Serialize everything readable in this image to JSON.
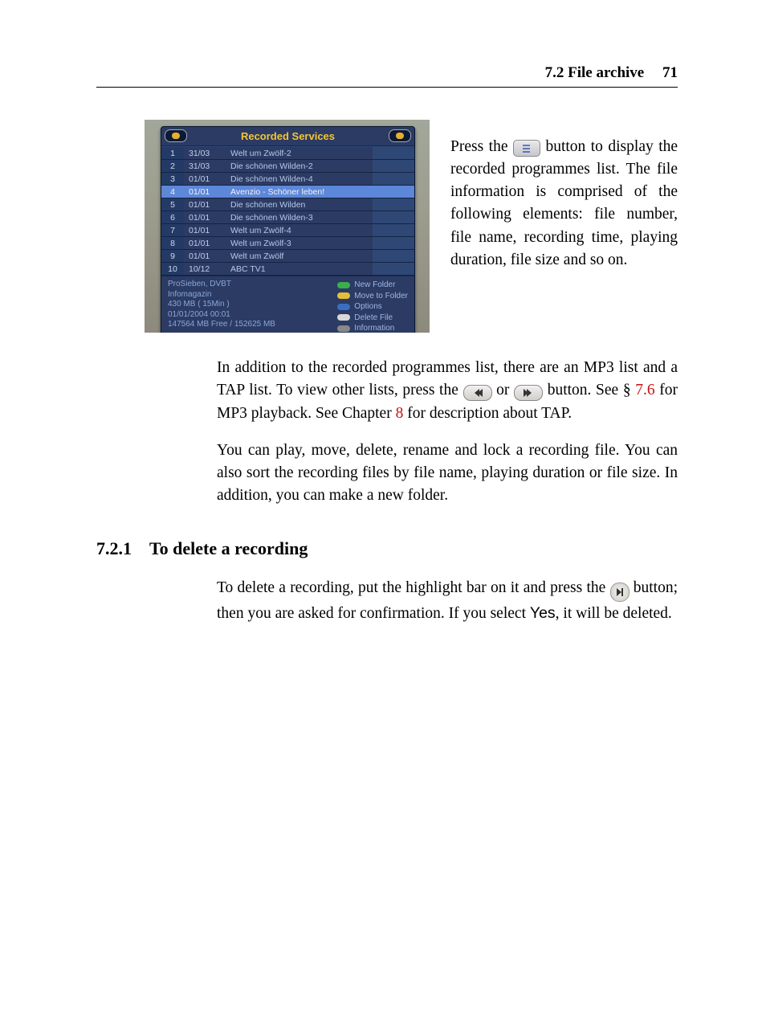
{
  "header": {
    "section_ref": "7.2 File archive",
    "page_number": "71"
  },
  "screenshot": {
    "title": "Recorded Services",
    "rows": [
      {
        "n": "1",
        "d": "31/03",
        "name": "Welt um Zwölf-2",
        "sel": false
      },
      {
        "n": "2",
        "d": "31/03",
        "name": "Die schönen Wilden-2",
        "sel": false
      },
      {
        "n": "3",
        "d": "01/01",
        "name": "Die schönen Wilden-4",
        "sel": false
      },
      {
        "n": "4",
        "d": "01/01",
        "name": "Avenzio - Schöner leben!",
        "sel": true
      },
      {
        "n": "5",
        "d": "01/01",
        "name": "Die schönen Wilden",
        "sel": false
      },
      {
        "n": "6",
        "d": "01/01",
        "name": "Die schönen Wilden-3",
        "sel": false
      },
      {
        "n": "7",
        "d": "01/01",
        "name": "Welt um Zwölf-4",
        "sel": false
      },
      {
        "n": "8",
        "d": "01/01",
        "name": "Welt um Zwölf-3",
        "sel": false
      },
      {
        "n": "9",
        "d": "01/01",
        "name": "Welt um Zwölf",
        "sel": false
      },
      {
        "n": "10",
        "d": "10/12",
        "name": "ABC TV1",
        "sel": false
      }
    ],
    "meta": {
      "line1": "ProSieben, DVBT",
      "line2": "Infomagazin",
      "line3": "430 MB ( 15Min )",
      "line4": "01/01/2004 00:01",
      "line5": "147564 MB Free / 152625 MB"
    },
    "legend": {
      "l1": "New Folder",
      "l2": "Move to Folder",
      "l3": "Options",
      "l4": "Delete File",
      "l5": "Information"
    }
  },
  "text": {
    "side": {
      "p1a": "Press the ",
      "p1b": " button to display the recorded programmes list.  The file information is comprised of the following elements: file number, file name, recording time, playing duration, file size and so on."
    },
    "p2a": "In addition to the recorded programmes list, there are an MP3 list and a TAP list. To view other lists, press the ",
    "p2b": " or ",
    "p2c": " button. See § ",
    "p2_link1": "7.6",
    "p2d": " for MP3 playback. See Chapter ",
    "p2_link2": "8",
    "p2e": " for description about TAP.",
    "p3": "You can play, move, delete, rename and lock a recording file. You can also sort the recording files by file name, playing duration or file size. In addition, you can make a new folder.",
    "h1_num": "7.2.1",
    "h1_title": "To delete a recording",
    "p4a": "To delete a recording, put the highlight bar on it and press the ",
    "p4b": " button; then you are asked for confirmation. If you select ",
    "p4_yes": "Yes",
    "p4c": ", it will be deleted."
  }
}
